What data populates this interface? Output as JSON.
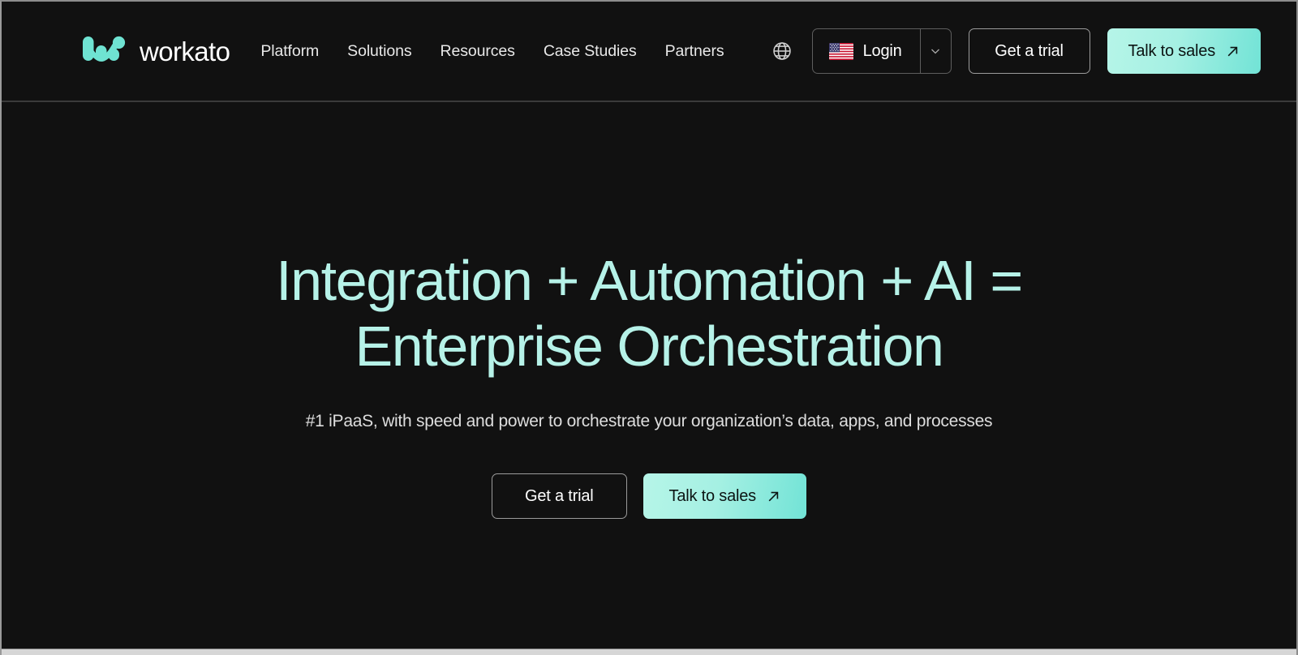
{
  "brand": {
    "name": "workato",
    "logo_icon": "workato-w-mark",
    "logo_color": "#6fe3d2"
  },
  "nav": {
    "items": [
      {
        "label": "Platform"
      },
      {
        "label": "Solutions"
      },
      {
        "label": "Resources"
      },
      {
        "label": "Case Studies"
      },
      {
        "label": "Partners"
      }
    ]
  },
  "header_actions": {
    "globe_icon": "globe-icon",
    "login": {
      "label": "Login",
      "flag_icon": "us-flag-icon",
      "caret_icon": "chevron-down-icon"
    },
    "trial_label": "Get a trial",
    "sales_label": "Talk to sales",
    "sales_icon": "arrow-up-right-icon"
  },
  "hero": {
    "title_line_1": "Integration + Automation + AI =",
    "title_line_2": "Enterprise Orchestration",
    "subtitle": "#1 iPaaS, with speed and power to orchestrate your organization’s data, apps, and processes",
    "trial_label": "Get a trial",
    "sales_label": "Talk to sales",
    "sales_icon": "arrow-up-right-icon"
  },
  "colors": {
    "background": "#111111",
    "accent_mint": "#6fe3d2",
    "headline_mint": "#b6f2e8",
    "text_primary": "#ffffff",
    "text_secondary": "#dedede",
    "divider": "#3b3b3b"
  }
}
